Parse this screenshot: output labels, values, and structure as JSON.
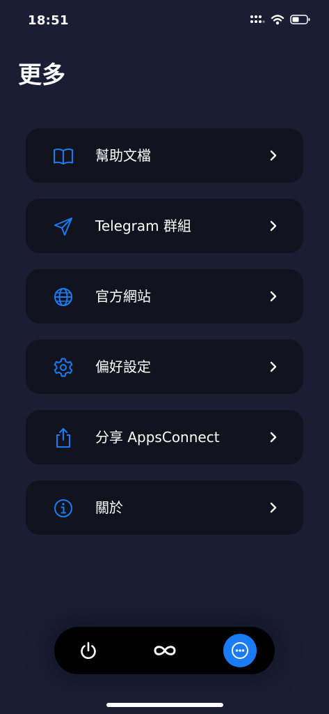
{
  "status_bar": {
    "time": "18:51",
    "icons": [
      "signal-icon",
      "wifi-icon",
      "battery-icon"
    ]
  },
  "page": {
    "title": "更多"
  },
  "menu": {
    "items": [
      {
        "label": "幫助文檔",
        "icon": "book-icon"
      },
      {
        "label": "Telegram 群組",
        "icon": "paper-plane-icon"
      },
      {
        "label": "官方網站",
        "icon": "globe-icon"
      },
      {
        "label": "偏好設定",
        "icon": "gear-icon"
      },
      {
        "label": "分享 AppsConnect",
        "icon": "share-icon"
      },
      {
        "label": "關於",
        "icon": "info-icon"
      }
    ]
  },
  "tab_bar": {
    "tabs": [
      {
        "icon": "power-icon",
        "selected": false
      },
      {
        "icon": "infinity-icon",
        "selected": false
      },
      {
        "icon": "more-icon",
        "selected": true
      }
    ]
  },
  "colors": {
    "background": "#1b1d35",
    "card": "#11131f",
    "accent": "#1a7cf5",
    "text": "#ffffff"
  }
}
